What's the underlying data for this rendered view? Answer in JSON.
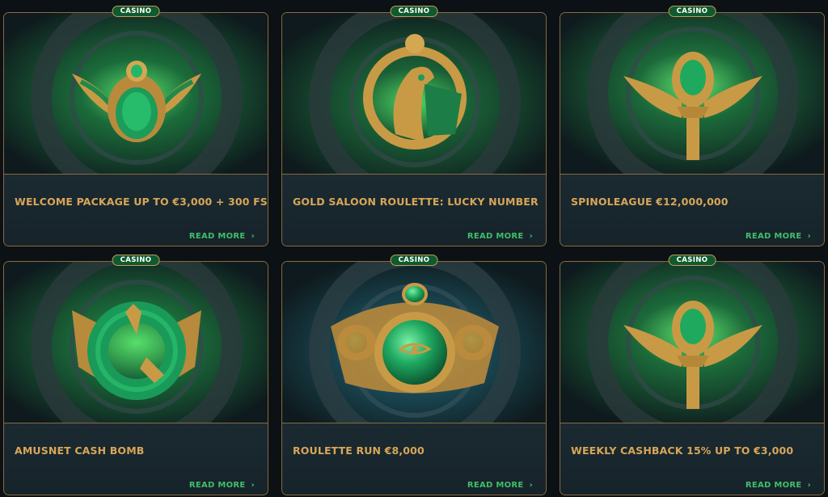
{
  "badge_label": "CASINO",
  "read_more_label": "READ MORE",
  "colors": {
    "gold": "#d8a659",
    "green_link": "#3fbf6a",
    "card_bg": "#17242b",
    "border": "#8a6b3e",
    "page_bg": "#0b1114"
  },
  "promotions": [
    {
      "title": "WELCOME PACKAGE UP TO €3,000 + 300 FS",
      "icon": "scarab-icon"
    },
    {
      "title": "GOLD SALOON ROULETTE: LUCKY NUMBER",
      "icon": "horus-falcon-icon"
    },
    {
      "title": "SPINOLEAGUE €12,000,000",
      "icon": "winged-ankh-icon"
    },
    {
      "title": "AMUSNET CASH BOMB",
      "icon": "crocodile-icon"
    },
    {
      "title": "ROULETTE RUN €8,000",
      "icon": "eye-of-horus-icon"
    },
    {
      "title": "WEEKLY CASHBACK 15% UP TO €3,000",
      "icon": "winged-ankh-icon"
    }
  ]
}
